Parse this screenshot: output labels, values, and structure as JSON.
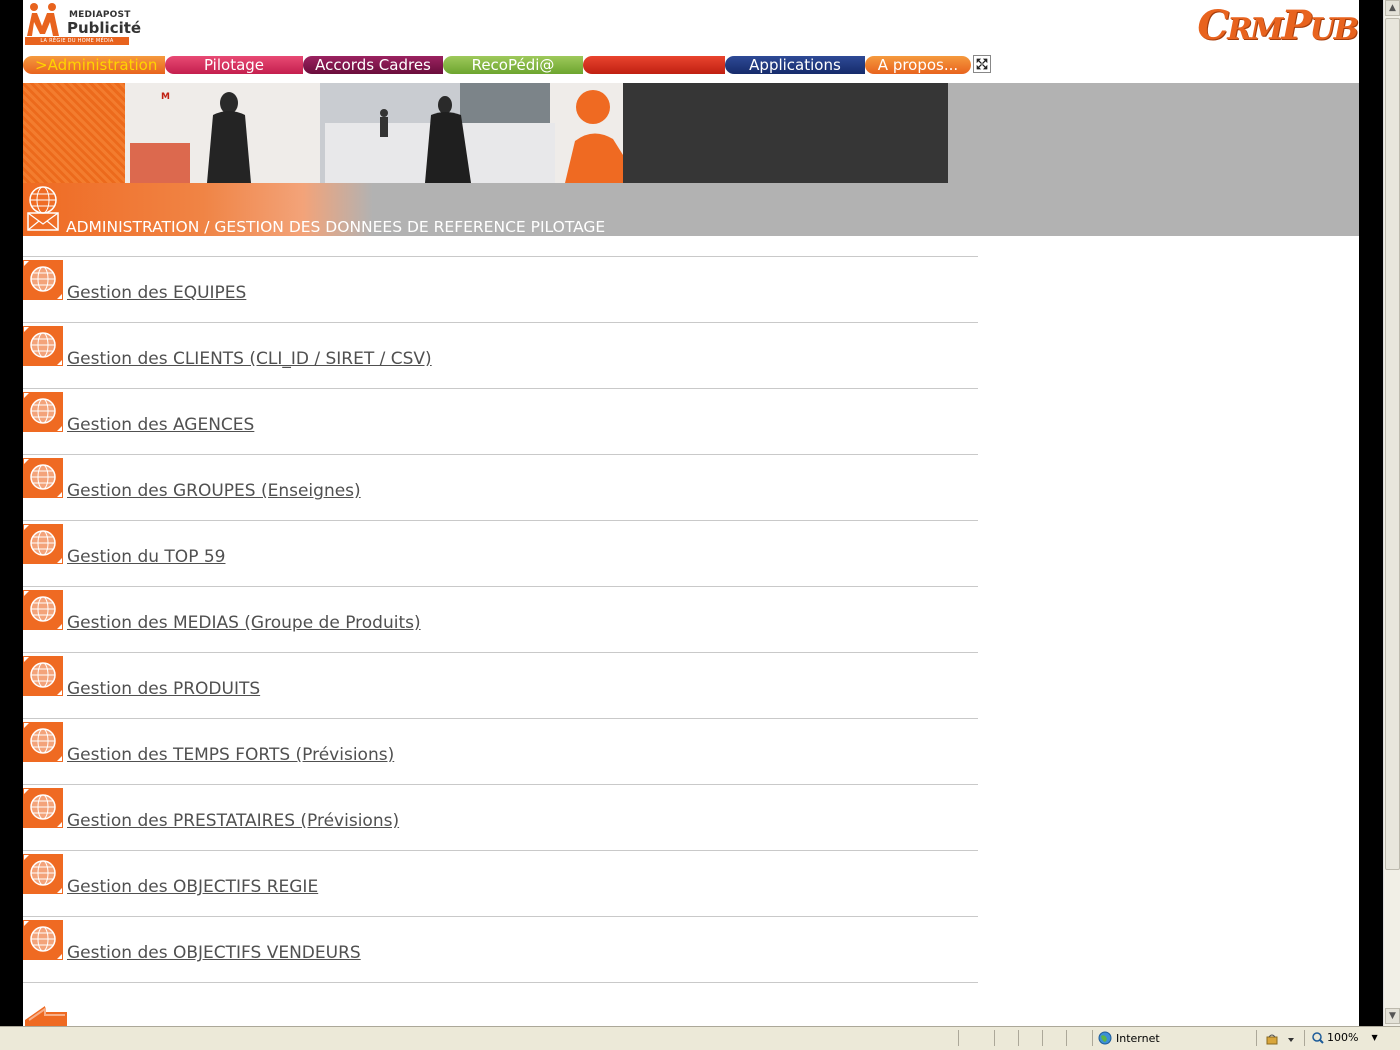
{
  "header": {
    "logo": {
      "line1": "MEDIAPOST",
      "line2": "Publicité",
      "tagline": "LA RÉGIE DU HOME MÉDIA"
    },
    "brand": {
      "part1": "C",
      "part2": "RM",
      "part3": "P",
      "part4": "UB"
    }
  },
  "nav": {
    "tabs": [
      {
        "label": ">Administration",
        "active": true
      },
      {
        "label": "Pilotage"
      },
      {
        "label": "Accords Cadres"
      },
      {
        "label": "RecoPédi@"
      },
      {
        "label": ""
      },
      {
        "label": "Applications"
      },
      {
        "label": "A propos..."
      }
    ],
    "fullscreen_icon": "fullscreen-icon"
  },
  "section": {
    "title": "ADMINISTRATION / GESTION DES DONNEES DE REFERENCE PILOTAGE"
  },
  "links": [
    {
      "label": "Gestion des EQUIPES"
    },
    {
      "label": "Gestion des CLIENTS (CLI_ID / SIRET / CSV)"
    },
    {
      "label": "Gestion des AGENCES"
    },
    {
      "label": "Gestion des GROUPES (Enseignes)"
    },
    {
      "label": "Gestion du TOP 59"
    },
    {
      "label": "Gestion des MEDIAS (Groupe de Produits)"
    },
    {
      "label": "Gestion des PRODUITS"
    },
    {
      "label": "Gestion des TEMPS FORTS (Prévisions)"
    },
    {
      "label": "Gestion des PRESTATAIRES (Prévisions)"
    },
    {
      "label": "Gestion des OBJECTIFS REGIE"
    },
    {
      "label": "Gestion des OBJECTIFS VENDEURS"
    }
  ],
  "statusbar": {
    "zone": "Internet",
    "zoom": "100%"
  },
  "colors": {
    "accent": "#e8631e",
    "banner_gray": "#b2b2b2",
    "link": "#505050"
  }
}
